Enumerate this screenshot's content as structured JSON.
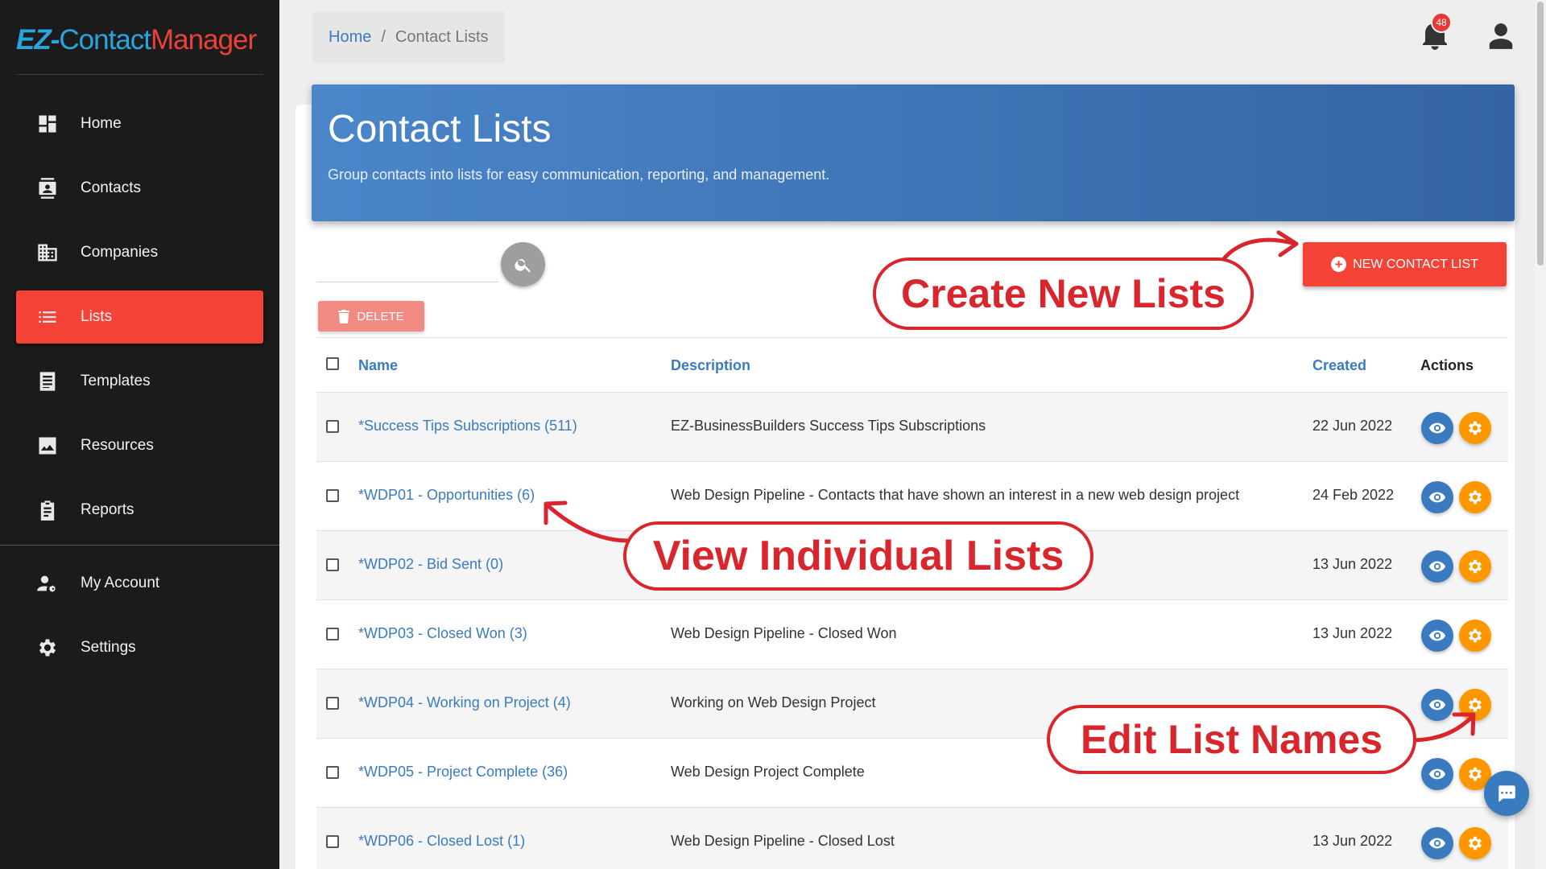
{
  "app": {
    "logo_ez": "EZ-",
    "logo_contact": "Contact",
    "logo_manager": "Manager"
  },
  "sidebar": {
    "items": [
      {
        "label": "Home",
        "icon": "dashboard-icon"
      },
      {
        "label": "Contacts",
        "icon": "contact-card-icon"
      },
      {
        "label": "Companies",
        "icon": "building-icon"
      },
      {
        "label": "Lists",
        "icon": "list-icon",
        "active": true
      },
      {
        "label": "Templates",
        "icon": "template-icon"
      },
      {
        "label": "Resources",
        "icon": "image-icon"
      },
      {
        "label": "Reports",
        "icon": "clipboard-icon"
      },
      {
        "label": "My Account",
        "icon": "user-gear-icon"
      },
      {
        "label": "Settings",
        "icon": "gear-icon"
      }
    ]
  },
  "breadcrumb": {
    "home": "Home",
    "separator": "/",
    "current": "Contact Lists"
  },
  "topbar": {
    "notification_count": "48"
  },
  "header": {
    "title": "Contact Lists",
    "subtitle": "Group contacts into lists for easy communication, reporting, and management."
  },
  "toolbar": {
    "search_placeholder": "",
    "delete_label": "DELETE",
    "new_label": "NEW CONTACT LIST"
  },
  "table": {
    "columns": {
      "name": "Name",
      "description": "Description",
      "created": "Created",
      "actions": "Actions"
    },
    "rows": [
      {
        "name": "*Success Tips Subscriptions (511)",
        "description": "EZ-BusinessBuilders Success Tips Subscriptions",
        "created": "22 Jun 2022"
      },
      {
        "name": "*WDP01 - Opportunities (6)",
        "description": "Web Design Pipeline - Contacts that have shown an interest in a new web design project",
        "created": "24 Feb 2022"
      },
      {
        "name": "*WDP02 - Bid Sent (0)",
        "description": "",
        "created": "13 Jun 2022"
      },
      {
        "name": "*WDP03 - Closed Won (3)",
        "description": "Web Design Pipeline - Closed Won",
        "created": "13 Jun 2022"
      },
      {
        "name": "*WDP04 - Working on Project (4)",
        "description": "Working on Web Design Project",
        "created": ""
      },
      {
        "name": "*WDP05 - Project Complete (36)",
        "description": "Web Design Project Complete",
        "created": ""
      },
      {
        "name": "*WDP06 - Closed Lost (1)",
        "description": "Web Design Pipeline - Closed Lost",
        "created": "13 Jun 2022"
      }
    ]
  },
  "annotations": {
    "create": "Create New Lists",
    "view": "View Individual Lists",
    "edit": "Edit List Names"
  },
  "colors": {
    "accent_red": "#f44336",
    "link_blue": "#3a7bc0",
    "edit_orange": "#ff9800",
    "sidebar_bg": "#1b1b1b",
    "annotation_red": "#d9262c"
  }
}
